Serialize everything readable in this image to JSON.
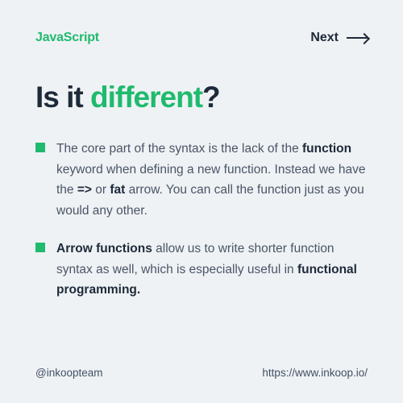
{
  "header": {
    "brand": "JavaScript",
    "next_label": "Next"
  },
  "title": {
    "part1": "Is it ",
    "highlight": "different",
    "part2": "?"
  },
  "points": [
    {
      "seg1": "The core part of the syntax is the lack of the ",
      "b1": "function",
      "seg2": " keyword when defining a new function. Instead we have the ",
      "b2": "=>",
      "seg3": " or ",
      "b3": "fat",
      "seg4": " arrow. You can call the function just as you would any other."
    },
    {
      "b1": "Arrow functions",
      "seg1": " allow us to write shorter function syntax as well, which is especially useful in ",
      "b2": "functional programming.",
      "seg2": ""
    }
  ],
  "footer": {
    "handle": "@inkoopteam",
    "url": "https://www.inkoop.io/"
  }
}
